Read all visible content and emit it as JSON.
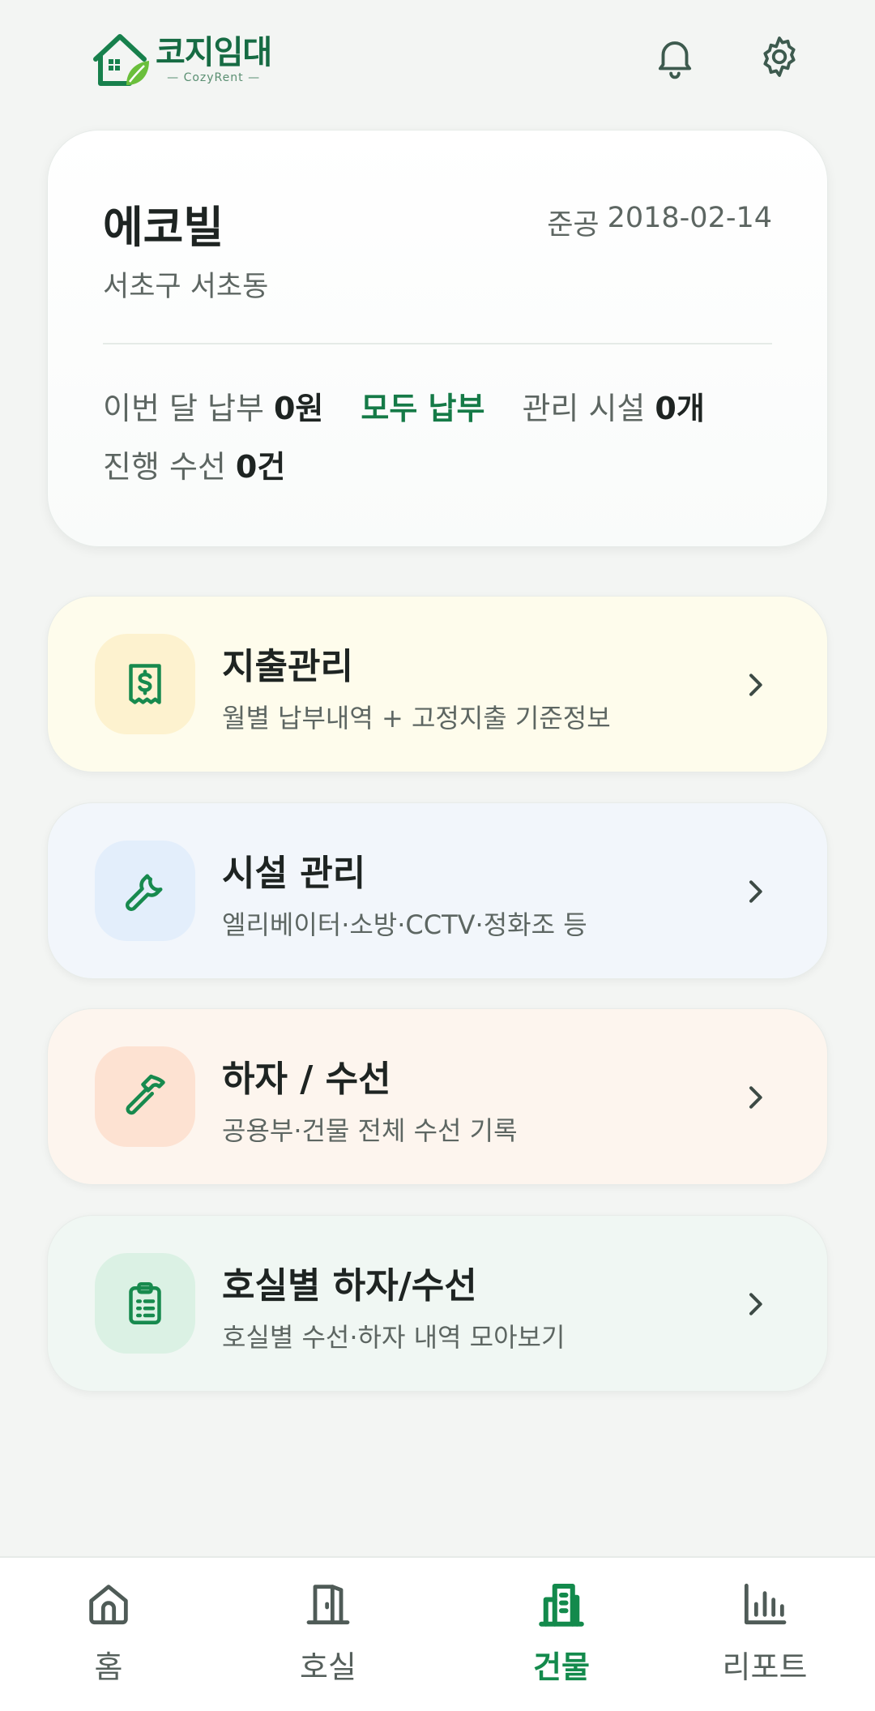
{
  "header": {
    "logo_ko": "코지임대",
    "logo_en": "— CozyRent —"
  },
  "building": {
    "name": "에코빌",
    "built_label": "준공",
    "built_date": "2018-02-14",
    "address": "서초구 서초동",
    "stats": {
      "payment_label": "이번 달 납부",
      "payment_value": "0원",
      "payment_status": "모두 납부",
      "facility_label": "관리 시설",
      "facility_value": "0개",
      "repair_label": "진행 수선",
      "repair_value": "0건"
    }
  },
  "menu": [
    {
      "title": "지출관리",
      "subtitle": "월별 납부내역 + 고정지출 기준정보"
    },
    {
      "title": "시설 관리",
      "subtitle": "엘리베이터·소방·CCTV·정화조 등"
    },
    {
      "title": "하자 / 수선",
      "subtitle": "공용부·건물 전체 수선 기록"
    },
    {
      "title": "호실별 하자/수선",
      "subtitle": "호실별 수선·하자 내역 모아보기"
    }
  ],
  "nav": {
    "items": [
      {
        "label": "홈"
      },
      {
        "label": "호실"
      },
      {
        "label": "건물"
      },
      {
        "label": "리포트"
      }
    ],
    "active_index": 2
  },
  "colors": {
    "brand_green": "#138a4c",
    "text_dark": "#1e2422",
    "text_muted": "#5d6662"
  }
}
